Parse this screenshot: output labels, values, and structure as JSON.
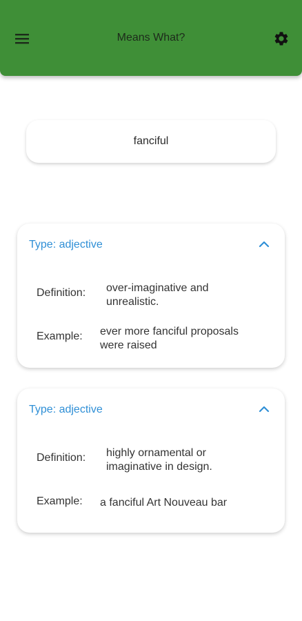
{
  "app": {
    "title": "Means What?",
    "menu_icon": "hamburger-menu-icon",
    "settings_icon": "gear-icon",
    "accent_color": "#3f8f37"
  },
  "search": {
    "value": "fanciful"
  },
  "entries": [
    {
      "type_label": "Type: adjective",
      "definition_label": "Definition:",
      "definition": "over-imaginative and unrealistic.",
      "example_label": "Example:",
      "example": "ever more fanciful proposals were raised",
      "toggle_icon": "chevron-up-icon"
    },
    {
      "type_label": "Type: adjective",
      "definition_label": "Definition:",
      "definition": "highly ornamental or imaginative in design.",
      "example_label": "Example:",
      "example": "a fanciful Art Nouveau bar",
      "toggle_icon": "chevron-up-icon"
    }
  ],
  "colors": {
    "type_label": "#2f8fd6"
  }
}
